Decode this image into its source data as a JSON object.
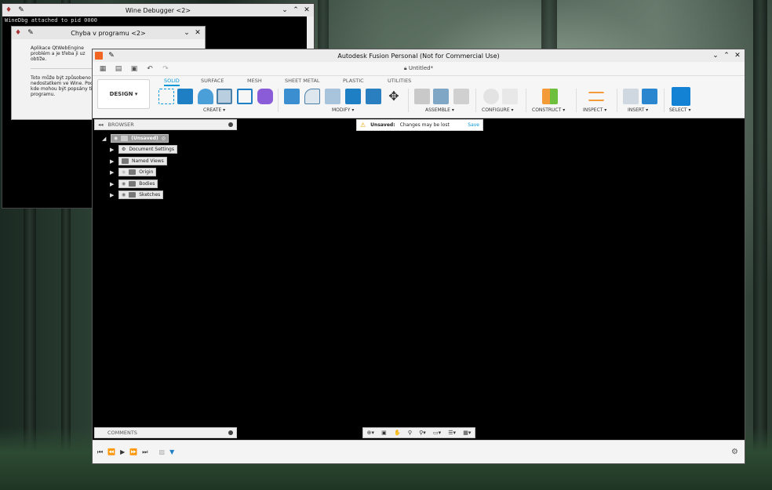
{
  "debugger": {
    "title": "Wine Debugger <2>",
    "console_text": "WineDbg attached to pid 0000"
  },
  "dialog": {
    "title": "Chyba v programu <2>",
    "para1": "Aplikace QtWebEngine\nproblém a je třeba ji uz\nobtíže.",
    "para2": "Toto může být způsobeno\nnedostatkem ve Wine. Pod\nkde mohou být popsány tip\nprogramu."
  },
  "fusion": {
    "title": "Autodesk Fusion Personal (Not for Commercial Use)",
    "doc_name": "Untitled*",
    "workspace": "DESIGN ▾",
    "tabs": [
      "SOLID",
      "SURFACE",
      "MESH",
      "SHEET METAL",
      "PLASTIC",
      "UTILITIES"
    ],
    "groups": [
      "CREATE ▾",
      "MODIFY ▾",
      "ASSEMBLE ▾",
      "CONFIGURE ▾",
      "CONSTRUCT ▾",
      "INSPECT ▾",
      "INSERT ▾",
      "SELECT ▾"
    ],
    "browser_label": "BROWSER",
    "comments_label": "COMMENTS",
    "unsaved": {
      "label": "Unsaved:",
      "message": "Changes may be lost",
      "action": "Save"
    },
    "tree": {
      "root": "(Unsaved)",
      "items": [
        "Document Settings",
        "Named Views",
        "Origin",
        "Bodies",
        "Sketches"
      ]
    }
  },
  "colors": {
    "accent": "#0696d7",
    "warning": "#e8a200",
    "fusion_logo": "#f26522"
  },
  "icons": {
    "window": [
      "pin-icon",
      "minimize-icon",
      "maximize-icon",
      "close-icon"
    ],
    "timeline": [
      "skip-start-icon",
      "step-back-icon",
      "play-icon",
      "step-forward-icon",
      "skip-end-icon",
      "settings-gear-icon"
    ]
  }
}
